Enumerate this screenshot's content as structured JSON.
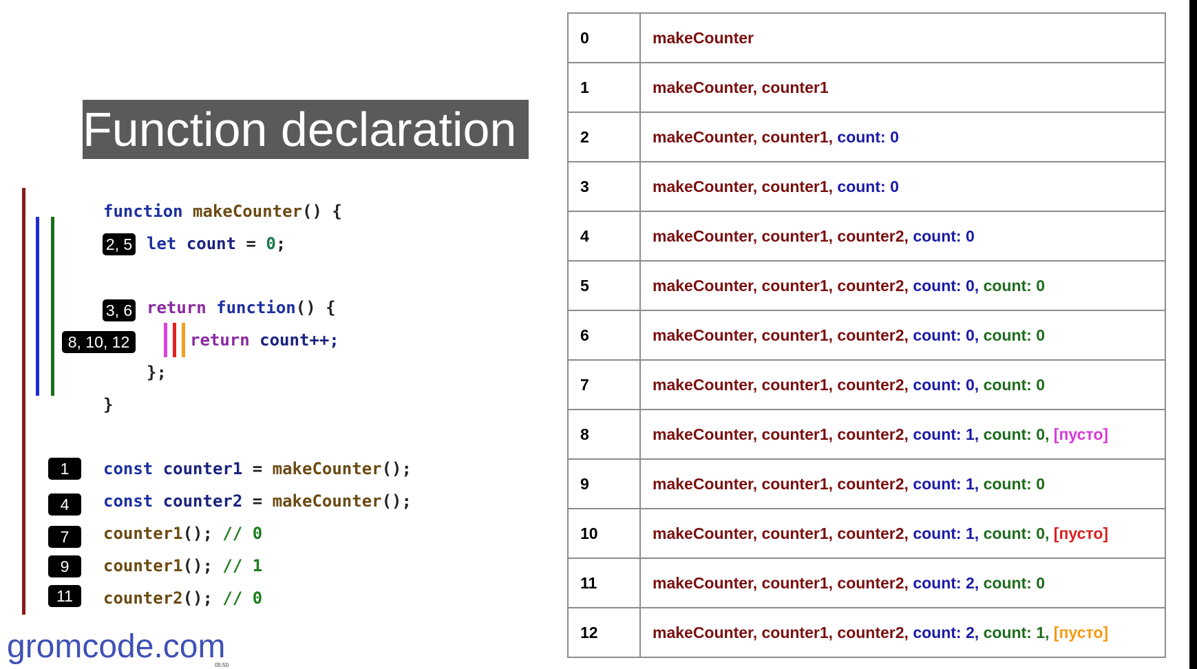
{
  "title": "Function declaration",
  "code": {
    "line1": {
      "kw": "function",
      "name": "makeCounter",
      "rest": "() {"
    },
    "line2": {
      "kw": "let",
      "var": "count",
      "op": " = ",
      "num": "0",
      "end": ";"
    },
    "line3": {
      "kw1": "return",
      "kw2": "function",
      "rest": "() {"
    },
    "line4": {
      "kw": "return",
      "var": "count++;"
    },
    "line5": "};",
    "line6": "}",
    "line7": {
      "kw": "const",
      "var": "counter1",
      "op": " = ",
      "fn": "makeCounter",
      "end": "();"
    },
    "line8": {
      "kw": "const",
      "var": "counter2",
      "op": " = ",
      "fn": "makeCounter",
      "end": "();"
    },
    "line9": {
      "fn": "counter1",
      "end": "();",
      "comment": "// 0"
    },
    "line10": {
      "fn": "counter1",
      "end": "();",
      "comment": "// 1"
    },
    "line11": {
      "fn": "counter2",
      "end": "();",
      "comment": "// 0"
    }
  },
  "badges": {
    "b25": "2, 5",
    "b36": "3, 6",
    "b81012": "8, 10, 12",
    "b1": "1",
    "b4": "4",
    "b7": "7",
    "b9": "9",
    "b11": "11"
  },
  "colors": {
    "scope_outer": "#8b1a1a",
    "scope_blue": "#1f2bd6",
    "scope_green": "#1b6e1b",
    "inner_magenta": "#e040e0",
    "inner_red": "#e02020",
    "inner_orange": "#f0a020"
  },
  "table": {
    "rows": [
      {
        "num": "0",
        "parts": [
          {
            "t": "makeCounter",
            "c": "dark"
          }
        ]
      },
      {
        "num": "1",
        "parts": [
          {
            "t": "makeCounter, counter1",
            "c": "dark"
          }
        ]
      },
      {
        "num": "2",
        "parts": [
          {
            "t": "makeCounter, counter1",
            "c": "dark"
          },
          {
            "t": ", ",
            "c": "dark"
          },
          {
            "t": "count: 0",
            "c": "blue"
          }
        ]
      },
      {
        "num": "3",
        "parts": [
          {
            "t": "makeCounter, counter1",
            "c": "dark"
          },
          {
            "t": ", ",
            "c": "dark"
          },
          {
            "t": "count: 0",
            "c": "blue"
          }
        ]
      },
      {
        "num": "4",
        "parts": [
          {
            "t": "makeCounter, counter1, counter2",
            "c": "dark"
          },
          {
            "t": ", ",
            "c": "dark"
          },
          {
            "t": "count: 0",
            "c": "blue"
          }
        ]
      },
      {
        "num": "5",
        "parts": [
          {
            "t": "makeCounter, counter1, counter2",
            "c": "dark"
          },
          {
            "t": ", ",
            "c": "dark"
          },
          {
            "t": "count: 0",
            "c": "blue"
          },
          {
            "t": ", ",
            "c": "blue"
          },
          {
            "t": "count: 0",
            "c": "green"
          }
        ]
      },
      {
        "num": "6",
        "parts": [
          {
            "t": "makeCounter, counter1, counter2",
            "c": "dark"
          },
          {
            "t": ", ",
            "c": "dark"
          },
          {
            "t": "count: 0",
            "c": "blue"
          },
          {
            "t": ", ",
            "c": "blue"
          },
          {
            "t": "count: 0",
            "c": "green"
          }
        ]
      },
      {
        "num": "7",
        "parts": [
          {
            "t": "makeCounter, counter1, counter2",
            "c": "dark"
          },
          {
            "t": ", ",
            "c": "dark"
          },
          {
            "t": "count: 0",
            "c": "blue"
          },
          {
            "t": ", ",
            "c": "blue"
          },
          {
            "t": "count: 0",
            "c": "green"
          }
        ]
      },
      {
        "num": "8",
        "parts": [
          {
            "t": "makeCounter, counter1, counter2",
            "c": "dark"
          },
          {
            "t": ", ",
            "c": "dark"
          },
          {
            "t": "count: 1",
            "c": "blue"
          },
          {
            "t": ", ",
            "c": "blue"
          },
          {
            "t": "count: 0",
            "c": "green"
          },
          {
            "t": ", ",
            "c": "green"
          },
          {
            "t": "[пусто]",
            "c": "magenta"
          }
        ]
      },
      {
        "num": "9",
        "parts": [
          {
            "t": "makeCounter, counter1, counter2",
            "c": "dark"
          },
          {
            "t": ", ",
            "c": "dark"
          },
          {
            "t": "count: 1",
            "c": "blue"
          },
          {
            "t": ", ",
            "c": "blue"
          },
          {
            "t": "count: 0",
            "c": "green"
          }
        ]
      },
      {
        "num": "10",
        "parts": [
          {
            "t": "makeCounter, counter1, counter2",
            "c": "dark"
          },
          {
            "t": ", ",
            "c": "dark"
          },
          {
            "t": "count: 1",
            "c": "blue"
          },
          {
            "t": ", ",
            "c": "blue"
          },
          {
            "t": "count: 0",
            "c": "green"
          },
          {
            "t": ", ",
            "c": "green"
          },
          {
            "t": "[пусто]",
            "c": "red"
          }
        ]
      },
      {
        "num": "11",
        "parts": [
          {
            "t": "makeCounter, counter1, counter2",
            "c": "dark"
          },
          {
            "t": ", ",
            "c": "dark"
          },
          {
            "t": "count: 2",
            "c": "blue"
          },
          {
            "t": ", ",
            "c": "blue"
          },
          {
            "t": "count: 0",
            "c": "green"
          }
        ]
      },
      {
        "num": "12",
        "parts": [
          {
            "t": "makeCounter, counter1, counter2",
            "c": "dark"
          },
          {
            "t": ", ",
            "c": "dark"
          },
          {
            "t": "count: 2",
            "c": "blue"
          },
          {
            "t": ", ",
            "c": "blue"
          },
          {
            "t": "count: 1",
            "c": "green"
          },
          {
            "t": ", ",
            "c": "green"
          },
          {
            "t": "[пусто]",
            "c": "orange"
          }
        ]
      }
    ]
  },
  "logo": "gromcode.com",
  "timestamp": "05:50"
}
